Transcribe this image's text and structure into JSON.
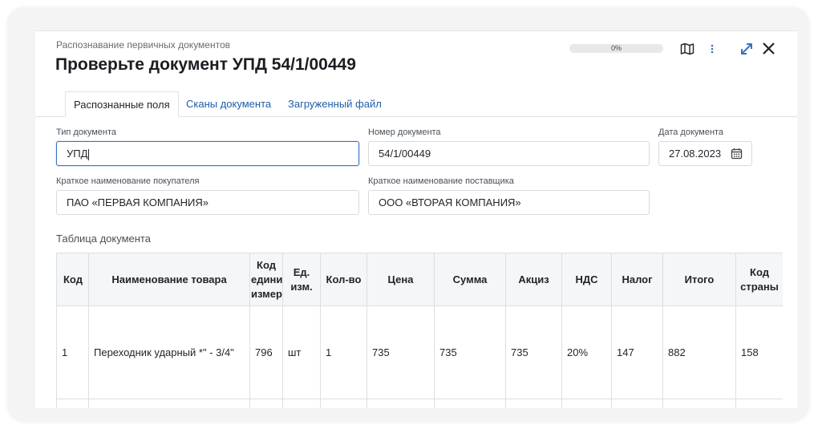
{
  "header": {
    "subtitle": "Распознавание первичных документов",
    "title": "Проверьте документ УПД 54/1/00449",
    "progress_label": "0%",
    "progress_fraction": 0
  },
  "tabs": [
    {
      "label": "Распознанные поля",
      "active": true
    },
    {
      "label": "Сканы документа",
      "active": false
    },
    {
      "label": "Загруженный файл",
      "active": false
    }
  ],
  "fields": {
    "doc_type": {
      "label": "Тип документа",
      "value": "УПД"
    },
    "doc_number": {
      "label": "Номер документа",
      "value": "54/1/00449"
    },
    "doc_date": {
      "label": "Дата документа",
      "value": "27.08.2023"
    },
    "buyer": {
      "label": "Краткое наименование покупателя",
      "value": "ПАО «ПЕРВАЯ КОМПАНИЯ»"
    },
    "supplier": {
      "label": "Краткое наименование поставщика",
      "value": "ООО «ВТОРАЯ КОМПАНИЯ»"
    }
  },
  "table": {
    "title": "Таблица документа",
    "columns": [
      "Код",
      "Наименование товара",
      "Код единицы измерения",
      "Ед. изм.",
      "Кол-во",
      "Цена",
      "Сумма",
      "Акциз",
      "НДС",
      "Налог",
      "Итого",
      "Код страны"
    ],
    "rows": [
      [
        "1",
        "Переходник ударный *\" - 3/4\"",
        "796",
        "шт",
        "1",
        "735",
        "735",
        "735",
        "20%",
        "147",
        "882",
        "158"
      ]
    ]
  },
  "icons": {
    "map": "map-icon",
    "more": "more-vertical-icon",
    "expand": "expand-icon",
    "close": "close-icon",
    "calendar": "calendar-icon"
  },
  "colors": {
    "accent": "#3b73c2",
    "link": "#1f5ea8"
  }
}
